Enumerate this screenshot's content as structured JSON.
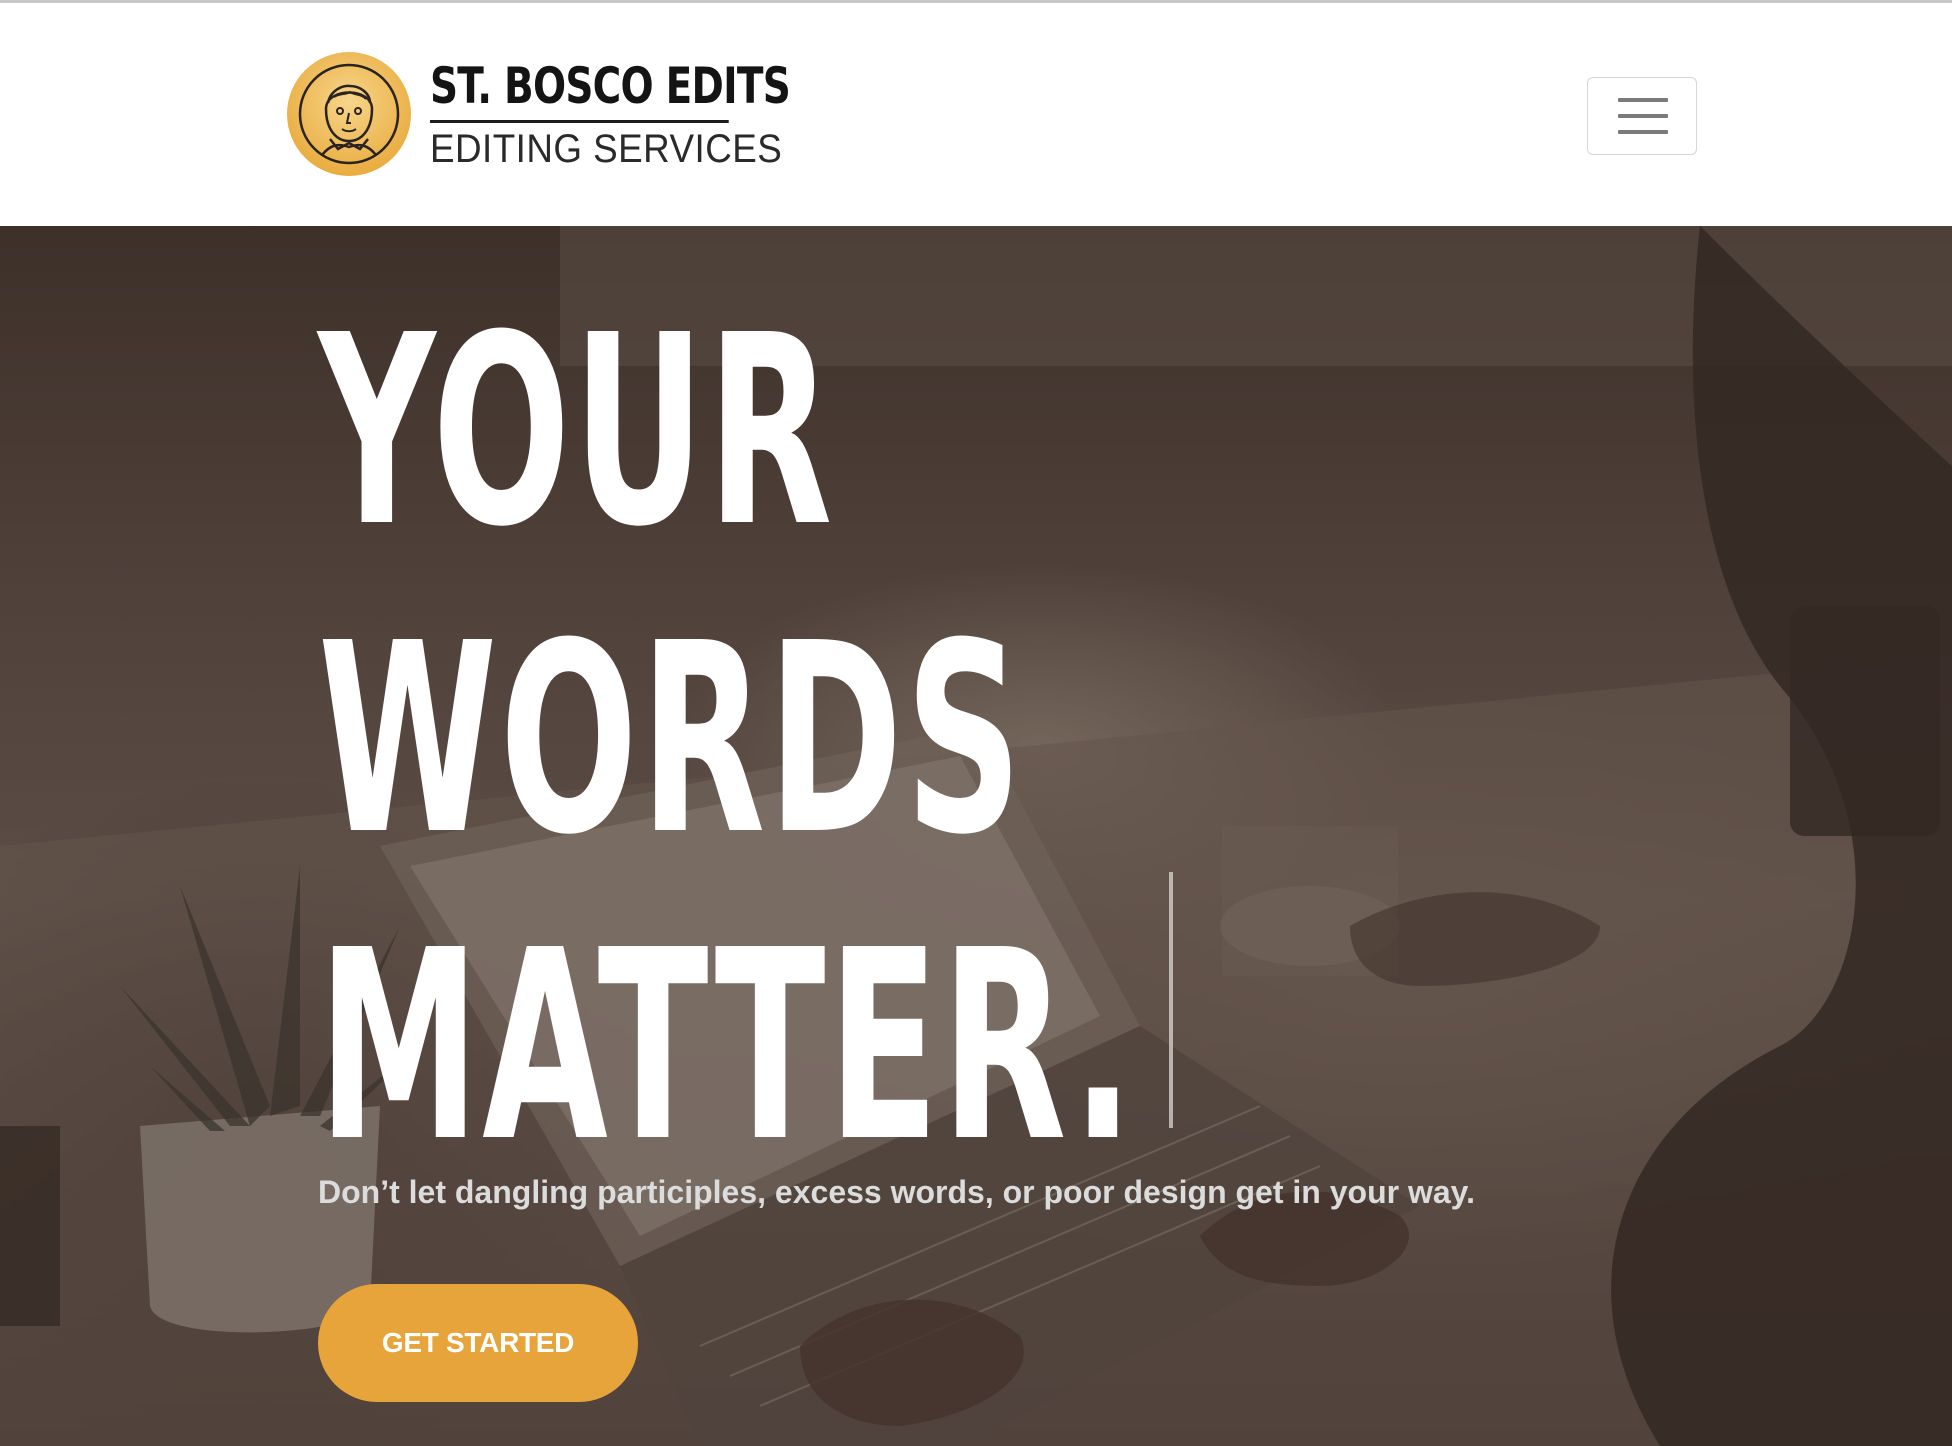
{
  "brand": {
    "name": "ST. BOSCO EDITS",
    "tagline": "EDITING SERVICES",
    "seal_icon": "portrait-seal-icon"
  },
  "nav": {
    "toggle_icon": "hamburger-menu-icon"
  },
  "hero": {
    "headline_lines": [
      "YOUR",
      "WORDS",
      "MATTER."
    ],
    "subtitle": "Don’t let dangling participles, excess words, or poor design get in your way.",
    "cta_label": "GET STARTED"
  },
  "colors": {
    "accent": "#e6a43a",
    "seal_gold": "#f0c35a",
    "text_dark": "#141414",
    "hero_overlay": "#3c2d26"
  }
}
